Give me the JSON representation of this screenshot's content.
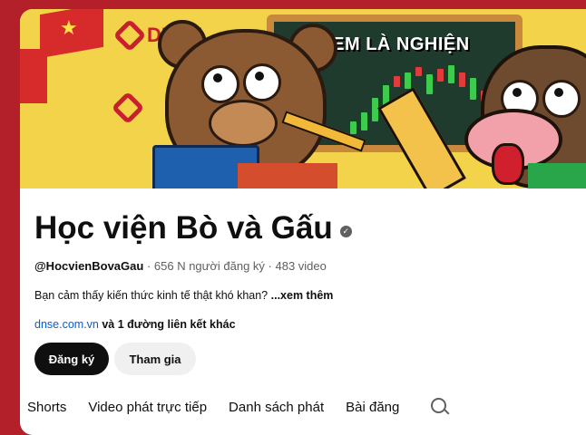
{
  "banner": {
    "logo_text": "DNSE",
    "board_text": "XEM LÀ NGHIỆN"
  },
  "channel": {
    "name": "Học viện Bò và Gấu",
    "handle": "@HocvienBovaGau",
    "subscribers": "656 N người đăng ký",
    "videos": "483 video",
    "separator": " · ",
    "description": "Bạn cảm thấy kiến thức kinh tế thật khó khan?",
    "more": "...xem thêm",
    "link_url": "dnse.com.vn",
    "link_extra": "và 1 đường liên kết khác"
  },
  "actions": {
    "subscribe": "Đăng ký",
    "join": "Tham gia"
  },
  "tabs": [
    {
      "label": "Shorts"
    },
    {
      "label": "Video phát trực tiếp"
    },
    {
      "label": "Danh sách phát"
    },
    {
      "label": "Bài đăng"
    }
  ],
  "icons": {
    "verified": "verified-check-icon",
    "search": "search-icon"
  },
  "colors": {
    "background": "#b3202a",
    "subscribe_bg": "#0f0f0f",
    "link": "#065fd4"
  }
}
